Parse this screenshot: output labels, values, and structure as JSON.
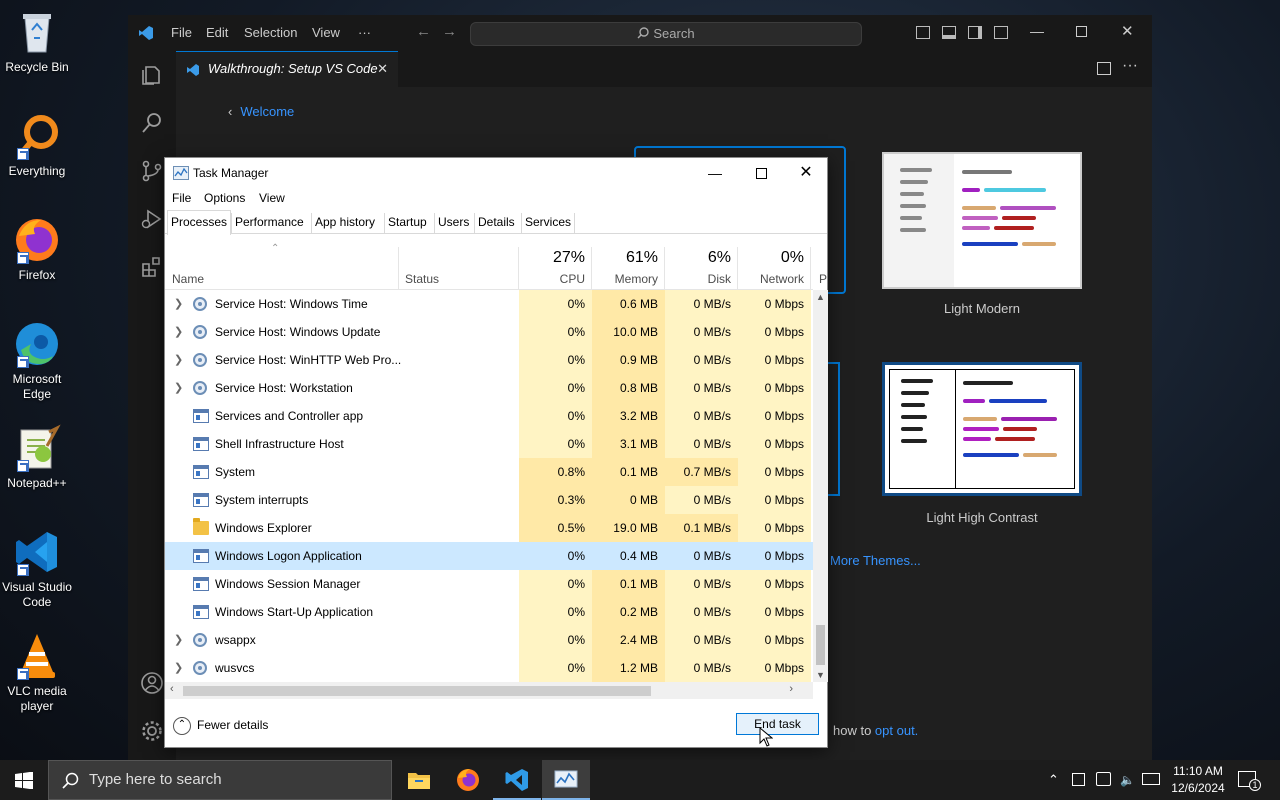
{
  "desktop": {
    "icons": [
      {
        "label": "Recycle Bin"
      },
      {
        "label": "Everything"
      },
      {
        "label": "Firefox"
      },
      {
        "label": "Microsoft Edge"
      },
      {
        "label": "Notepad++"
      },
      {
        "label": "Visual Studio Code"
      },
      {
        "label": "VLC media player"
      }
    ]
  },
  "vscode": {
    "menu": [
      "File",
      "Edit",
      "Selection",
      "View",
      "···"
    ],
    "search_label": "Search",
    "tab_title": "Walkthrough: Setup VS Code",
    "tab_close": "✕",
    "back_link": "Welcome",
    "themes": [
      {
        "label": "Light Modern"
      },
      {
        "label": "Light High Contrast"
      }
    ],
    "more_themes": "More Themes...",
    "opt_out_prefix": "how to ",
    "opt_out_link": "opt out."
  },
  "task_manager": {
    "title": "Task Manager",
    "menu": [
      "File",
      "Options",
      "View"
    ],
    "tabs": [
      "Processes",
      "Performance",
      "App history",
      "Startup",
      "Users",
      "Details",
      "Services"
    ],
    "active_tab": "Processes",
    "columns": {
      "name": "Name",
      "status": "Status",
      "cpu": {
        "pct": "27%",
        "label": "CPU"
      },
      "memory": {
        "pct": "61%",
        "label": "Memory"
      },
      "disk": {
        "pct": "6%",
        "label": "Disk"
      },
      "network": {
        "pct": "0%",
        "label": "Network"
      },
      "power": "P"
    },
    "processes": [
      {
        "name": "Service Host: Windows Time",
        "icon": "gear-icon",
        "expand": true,
        "cpu": "0%",
        "mem": "0.6 MB",
        "disk": "0 MB/s",
        "net": "0 Mbps"
      },
      {
        "name": "Service Host: Windows Update",
        "icon": "gear-icon",
        "expand": true,
        "cpu": "0%",
        "mem": "10.0 MB",
        "disk": "0 MB/s",
        "net": "0 Mbps"
      },
      {
        "name": "Service Host: WinHTTP Web Pro...",
        "icon": "gear-icon",
        "expand": true,
        "cpu": "0%",
        "mem": "0.9 MB",
        "disk": "0 MB/s",
        "net": "0 Mbps"
      },
      {
        "name": "Service Host: Workstation",
        "icon": "gear-icon",
        "expand": true,
        "cpu": "0%",
        "mem": "0.8 MB",
        "disk": "0 MB/s",
        "net": "0 Mbps"
      },
      {
        "name": "Services and Controller app",
        "icon": "window-icon",
        "expand": false,
        "cpu": "0%",
        "mem": "3.2 MB",
        "disk": "0 MB/s",
        "net": "0 Mbps"
      },
      {
        "name": "Shell Infrastructure Host",
        "icon": "window-icon",
        "expand": false,
        "cpu": "0%",
        "mem": "3.1 MB",
        "disk": "0 MB/s",
        "net": "0 Mbps"
      },
      {
        "name": "System",
        "icon": "window-icon",
        "expand": false,
        "cpu": "0.8%",
        "mem": "0.1 MB",
        "disk": "0.7 MB/s",
        "net": "0 Mbps"
      },
      {
        "name": "System interrupts",
        "icon": "window-icon",
        "expand": false,
        "cpu": "0.3%",
        "mem": "0 MB",
        "disk": "0 MB/s",
        "net": "0 Mbps"
      },
      {
        "name": "Windows Explorer",
        "icon": "folder-icon",
        "expand": false,
        "cpu": "0.5%",
        "mem": "19.0 MB",
        "disk": "0.1 MB/s",
        "net": "0 Mbps"
      },
      {
        "name": "Windows Logon Application",
        "icon": "window-icon",
        "expand": false,
        "selected": true,
        "cpu": "0%",
        "mem": "0.4 MB",
        "disk": "0 MB/s",
        "net": "0 Mbps"
      },
      {
        "name": "Windows Session Manager",
        "icon": "window-icon",
        "expand": false,
        "cpu": "0%",
        "mem": "0.1 MB",
        "disk": "0 MB/s",
        "net": "0 Mbps"
      },
      {
        "name": "Windows Start-Up Application",
        "icon": "window-icon",
        "expand": false,
        "cpu": "0%",
        "mem": "0.2 MB",
        "disk": "0 MB/s",
        "net": "0 Mbps"
      },
      {
        "name": "wsappx",
        "icon": "gear-icon",
        "expand": true,
        "cpu": "0%",
        "mem": "2.4 MB",
        "disk": "0 MB/s",
        "net": "0 Mbps"
      },
      {
        "name": "wusvcs",
        "icon": "gear-icon",
        "expand": true,
        "cpu": "0%",
        "mem": "1.2 MB",
        "disk": "0 MB/s",
        "net": "0 Mbps"
      }
    ],
    "fewer_details": "Fewer details",
    "end_task": "End task"
  },
  "taskbar": {
    "search_placeholder": "Type here to search",
    "apps": [
      "File Explorer",
      "Firefox",
      "Visual Studio Code",
      "Task Manager"
    ],
    "time": "11:10 AM",
    "date": "12/6/2024",
    "notification_count": "1"
  }
}
